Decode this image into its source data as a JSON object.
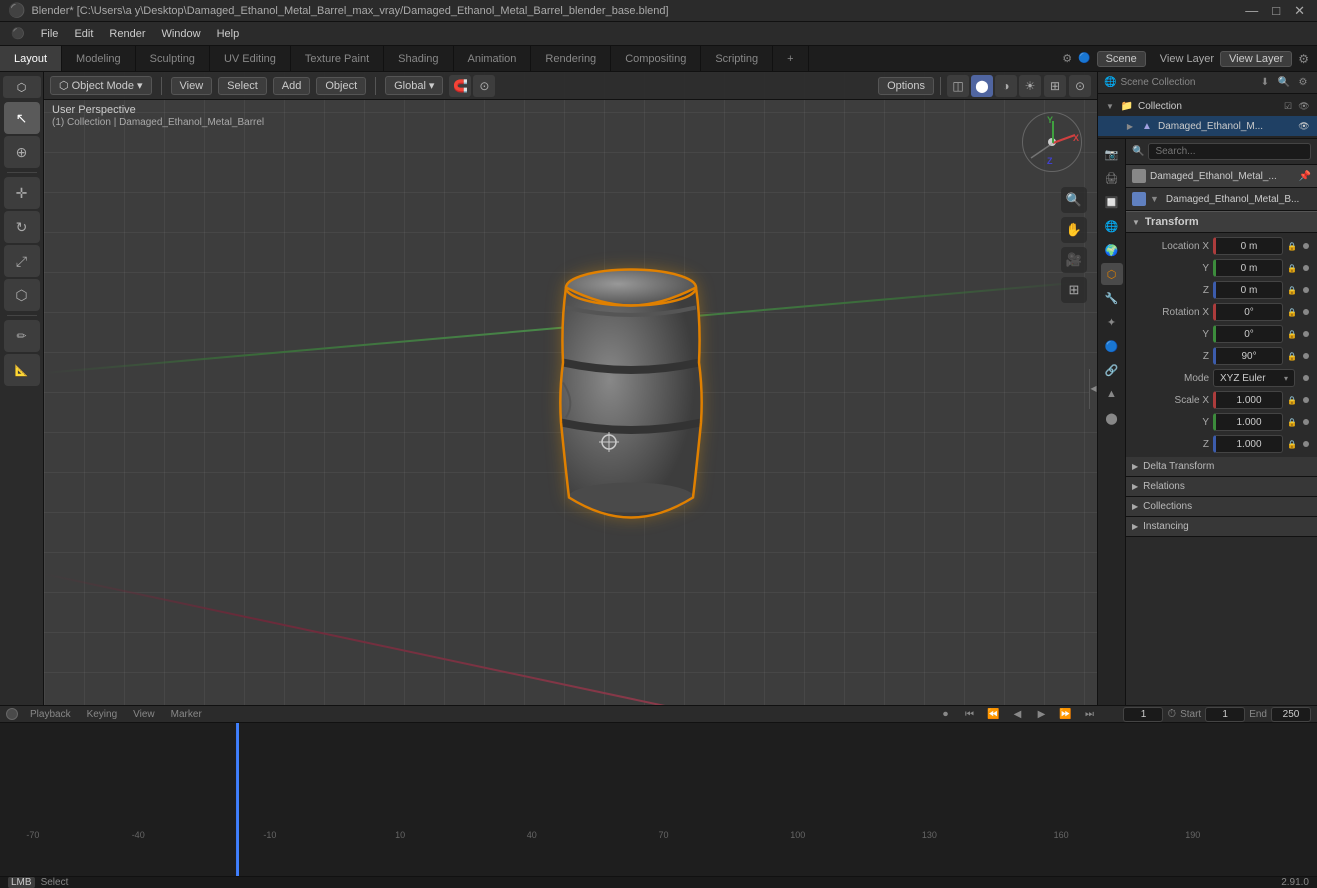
{
  "titlebar": {
    "title": "Blender* [C:\\Users\\a y\\Desktop\\Damaged_Ethanol_Metal_Barrel_max_vray/Damaged_Ethanol_Metal_Barrel_blender_base.blend]",
    "controls": [
      "—",
      "□",
      "✕"
    ]
  },
  "menubar": {
    "items": [
      "Blender",
      "File",
      "Edit",
      "Render",
      "Window",
      "Help"
    ]
  },
  "workspace_tabs": {
    "tabs": [
      "Layout",
      "Modeling",
      "Sculpting",
      "UV Editing",
      "Texture Paint",
      "Shading",
      "Animation",
      "Rendering",
      "Compositing",
      "Scripting"
    ],
    "active": "Layout",
    "add_icon": "+",
    "scene_label": "Scene",
    "view_layer_label": "View Layer"
  },
  "viewport": {
    "mode": "Object Mode",
    "header_items": [
      "View",
      "Select",
      "Add",
      "Object"
    ],
    "transform_mode": "Global",
    "options_label": "Options",
    "view_label": "User Perspective",
    "collection_info": "(1) Collection | Damaged_Ethanol_Metal_Barrel",
    "gizmo": {
      "x": "X",
      "y": "Y",
      "z": "Z"
    }
  },
  "outliner": {
    "scene_collection": "Scene Collection",
    "items": [
      {
        "label": "Collection",
        "icon": "□",
        "indent": 0,
        "expanded": true
      },
      {
        "label": "Damaged_Ethanol_M...",
        "icon": "▲",
        "indent": 1,
        "selected": true
      }
    ]
  },
  "properties": {
    "search_placeholder": "Search...",
    "object_name": "Damaged_Ethanol_Metal_...",
    "object_data": "Damaged_Ethanol_Metal_B...",
    "sections": {
      "transform": {
        "label": "Transform",
        "location": {
          "x": "0 m",
          "y": "0 m",
          "z": "0 m"
        },
        "rotation": {
          "x": "0°",
          "y": "0°",
          "z": "90°"
        },
        "mode": "XYZ Euler",
        "scale": {
          "x": "1.000",
          "y": "1.000",
          "z": "1.000"
        }
      },
      "delta_transform": "Delta Transform",
      "relations": "Relations",
      "collections": "Collections",
      "instancing": "Instancing"
    }
  },
  "timeline": {
    "tabs": [
      "Playback",
      "Keying",
      "View",
      "Marker"
    ],
    "current_frame": "1",
    "start": "1",
    "start_label": "Start",
    "end": "250",
    "end_label": "End"
  },
  "statusbar": {
    "select_label": "Select",
    "version": "2.91.0"
  },
  "icons": {
    "cursor": "⊕",
    "move": "✛",
    "rotate": "↻",
    "scale": "⤢",
    "transform": "⬡",
    "annotation": "✏",
    "measure": "📐",
    "search": "🔍",
    "camera": "🎥",
    "grid": "⊞",
    "expand": "▼",
    "collapse": "▶",
    "lock": "🔒",
    "dot": "●",
    "pin": "📌",
    "eye": "👁",
    "render": "📷",
    "cursor_3d": "⊕",
    "arrow_select": "↖",
    "box_select": "⬜"
  }
}
